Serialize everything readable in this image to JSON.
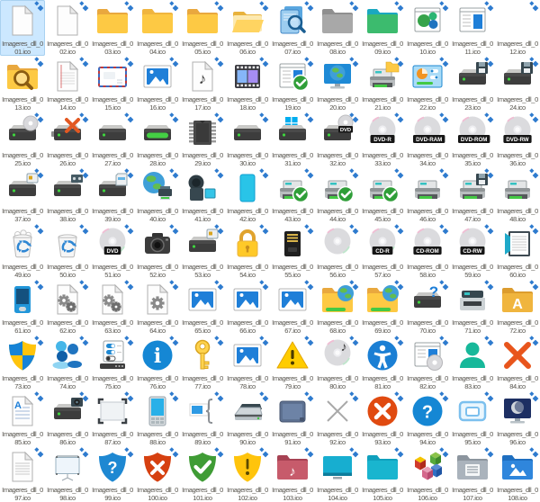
{
  "window": {
    "background": "#ffffff"
  },
  "grid": {
    "columns": 12,
    "rows": 9
  },
  "file_prefix": "Imageres_dll_0",
  "selection": {
    "background": "#cce8ff"
  },
  "overlay": {
    "name": "compressed-arrows-badge",
    "color": "#2e7bce"
  },
  "colors": {
    "folder_yellow": "#fdc944",
    "folder_flap": "#e9a83e",
    "shield_blue": "#1e88d2",
    "shield_red": "#d64010",
    "shield_green": "#3f9c35",
    "shield_yellow": "#ffc40c",
    "led_green": "#3ed43e",
    "label_text": "#55524b"
  },
  "items": [
    {
      "file": "01.ico",
      "icon": "blank-page",
      "selected": true
    },
    {
      "file": "02.ico",
      "icon": "blank-page"
    },
    {
      "file": "03.ico",
      "icon": "folder-flap"
    },
    {
      "file": "04.ico",
      "icon": "folder-plain"
    },
    {
      "file": "05.ico",
      "icon": "folder-flap"
    },
    {
      "file": "06.ico",
      "icon": "folder-open"
    },
    {
      "file": "07.ico",
      "icon": "docs-search"
    },
    {
      "file": "08.ico",
      "icon": "folder-gray"
    },
    {
      "file": "09.ico",
      "icon": "folder-green"
    },
    {
      "file": "10.ico",
      "icon": "window-spheres"
    },
    {
      "file": "11.ico",
      "icon": "window-doc"
    },
    {
      "file": "12.ico",
      "icon": "empty"
    },
    {
      "file": "13.ico",
      "icon": "folder-search"
    },
    {
      "file": "14.ico",
      "icon": "page-red-lines"
    },
    {
      "file": "15.ico",
      "icon": "envelope"
    },
    {
      "file": "16.ico",
      "icon": "picture"
    },
    {
      "file": "17.ico",
      "icon": "music-page"
    },
    {
      "file": "18.ico",
      "icon": "filmstrip"
    },
    {
      "file": "19.ico",
      "icon": "window-doc-check"
    },
    {
      "file": "20.ico",
      "icon": "monitor-globe"
    },
    {
      "file": "21.ico",
      "icon": "printer-folder"
    },
    {
      "file": "22.ico",
      "icon": "control-panel"
    },
    {
      "file": "23.ico",
      "icon": "drive-floppy"
    },
    {
      "file": "24.ico",
      "icon": "drive-floppy"
    },
    {
      "file": "25.ico",
      "icon": "drive-disc"
    },
    {
      "file": "26.ico",
      "icon": "drive-x"
    },
    {
      "file": "27.ico",
      "icon": "drive"
    },
    {
      "file": "28.ico",
      "icon": "drive-green-bar"
    },
    {
      "file": "29.ico",
      "icon": "memory-chip"
    },
    {
      "file": "30.ico",
      "icon": "drive"
    },
    {
      "file": "31.ico",
      "icon": "drive-windows"
    },
    {
      "file": "32.ico",
      "icon": "drive-dvd"
    },
    {
      "file": "33.ico",
      "icon": "disc",
      "disc_label": "DVD-R"
    },
    {
      "file": "34.ico",
      "icon": "disc",
      "disc_label": "DVD-RAM"
    },
    {
      "file": "35.ico",
      "icon": "disc",
      "disc_label": "DVD-ROM"
    },
    {
      "file": "36.ico",
      "icon": "disc",
      "disc_label": "DVD-RW"
    },
    {
      "file": "37.ico",
      "icon": "drive-card"
    },
    {
      "file": "38.ico",
      "icon": "drive-tape"
    },
    {
      "file": "39.ico",
      "icon": "drive-cartridge"
    },
    {
      "file": "40.ico",
      "icon": "globe-printer"
    },
    {
      "file": "41.ico",
      "icon": "camcorder"
    },
    {
      "file": "42.ico",
      "icon": "phone"
    },
    {
      "file": "43.ico",
      "icon": "printer-check"
    },
    {
      "file": "44.ico",
      "icon": "printer-check"
    },
    {
      "file": "45.ico",
      "icon": "printer-check"
    },
    {
      "file": "46.ico",
      "icon": "printer"
    },
    {
      "file": "47.ico",
      "icon": "printer-floppy"
    },
    {
      "file": "48.ico",
      "icon": "printer"
    },
    {
      "file": "49.ico",
      "icon": "recycle-full"
    },
    {
      "file": "50.ico",
      "icon": "recycle-empty"
    },
    {
      "file": "51.ico",
      "icon": "disc",
      "disc_label": "DVD"
    },
    {
      "file": "52.ico",
      "icon": "camera"
    },
    {
      "file": "53.ico",
      "icon": "drive-card"
    },
    {
      "file": "54.ico",
      "icon": "padlock"
    },
    {
      "file": "55.ico",
      "icon": "card-reader"
    },
    {
      "file": "56.ico",
      "icon": "disc"
    },
    {
      "file": "57.ico",
      "icon": "disc",
      "disc_label": "CD-R"
    },
    {
      "file": "58.ico",
      "icon": "disc",
      "disc_label": "CD-ROM"
    },
    {
      "file": "59.ico",
      "icon": "disc",
      "disc_label": "CD-RW"
    },
    {
      "file": "60.ico",
      "icon": "journal"
    },
    {
      "file": "61.ico",
      "icon": "media-player"
    },
    {
      "file": "62.ico",
      "icon": "gears-page"
    },
    {
      "file": "63.ico",
      "icon": "gears-page"
    },
    {
      "file": "64.ico",
      "icon": "gear-page"
    },
    {
      "file": "65.ico",
      "icon": "picture"
    },
    {
      "file": "66.ico",
      "icon": "picture"
    },
    {
      "file": "67.ico",
      "icon": "picture"
    },
    {
      "file": "68.ico",
      "icon": "folder-web"
    },
    {
      "file": "69.ico",
      "icon": "folder-web"
    },
    {
      "file": "70.ico",
      "icon": "drive-question"
    },
    {
      "file": "71.ico",
      "icon": "fax"
    },
    {
      "file": "72.ico",
      "icon": "folder-fonts"
    },
    {
      "file": "73.ico",
      "icon": "shield-uac"
    },
    {
      "file": "74.ico",
      "icon": "users"
    },
    {
      "file": "75.ico",
      "icon": "settings-panel"
    },
    {
      "file": "76.ico",
      "icon": "circle-info"
    },
    {
      "file": "77.ico",
      "icon": "key"
    },
    {
      "file": "78.ico",
      "icon": "picture"
    },
    {
      "file": "79.ico",
      "icon": "warning"
    },
    {
      "file": "80.ico",
      "icon": "disc-music"
    },
    {
      "file": "81.ico",
      "icon": "accessibility"
    },
    {
      "file": "82.ico",
      "icon": "window-disc"
    },
    {
      "file": "83.ico",
      "icon": "user"
    },
    {
      "file": "84.ico",
      "icon": "orange-x"
    },
    {
      "file": "85.ico",
      "icon": "doc-a"
    },
    {
      "file": "86.ico",
      "icon": "drive-camera"
    },
    {
      "file": "87.ico",
      "icon": "scan-region"
    },
    {
      "file": "88.ico",
      "icon": "pda"
    },
    {
      "file": "89.ico",
      "icon": "banner"
    },
    {
      "file": "90.ico",
      "icon": "scanner"
    },
    {
      "file": "91.ico",
      "icon": "tablet"
    },
    {
      "file": "92.ico",
      "icon": "thin-x"
    },
    {
      "file": "93.ico",
      "icon": "circle-x"
    },
    {
      "file": "94.ico",
      "icon": "circle-question"
    },
    {
      "file": "95.ico",
      "icon": "aero-window"
    },
    {
      "file": "96.ico",
      "icon": "monitor-moon"
    },
    {
      "file": "97.ico",
      "icon": "lined-page"
    },
    {
      "file": "98.ico",
      "icon": "projection-screen"
    },
    {
      "file": "99.ico",
      "icon": "shield-question"
    },
    {
      "file": "100.ico",
      "icon": "shield-x"
    },
    {
      "file": "101.ico",
      "icon": "shield-check"
    },
    {
      "file": "102.ico",
      "icon": "shield-exclaim"
    },
    {
      "file": "103.ico",
      "icon": "folder-music"
    },
    {
      "file": "104.ico",
      "icon": "monitor-teal"
    },
    {
      "file": "105.ico",
      "icon": "folder-teal"
    },
    {
      "file": "106.ico",
      "icon": "blocks"
    },
    {
      "file": "107.ico",
      "icon": "folder-docs"
    },
    {
      "file": "108.ico",
      "icon": "folder-pictures"
    }
  ]
}
